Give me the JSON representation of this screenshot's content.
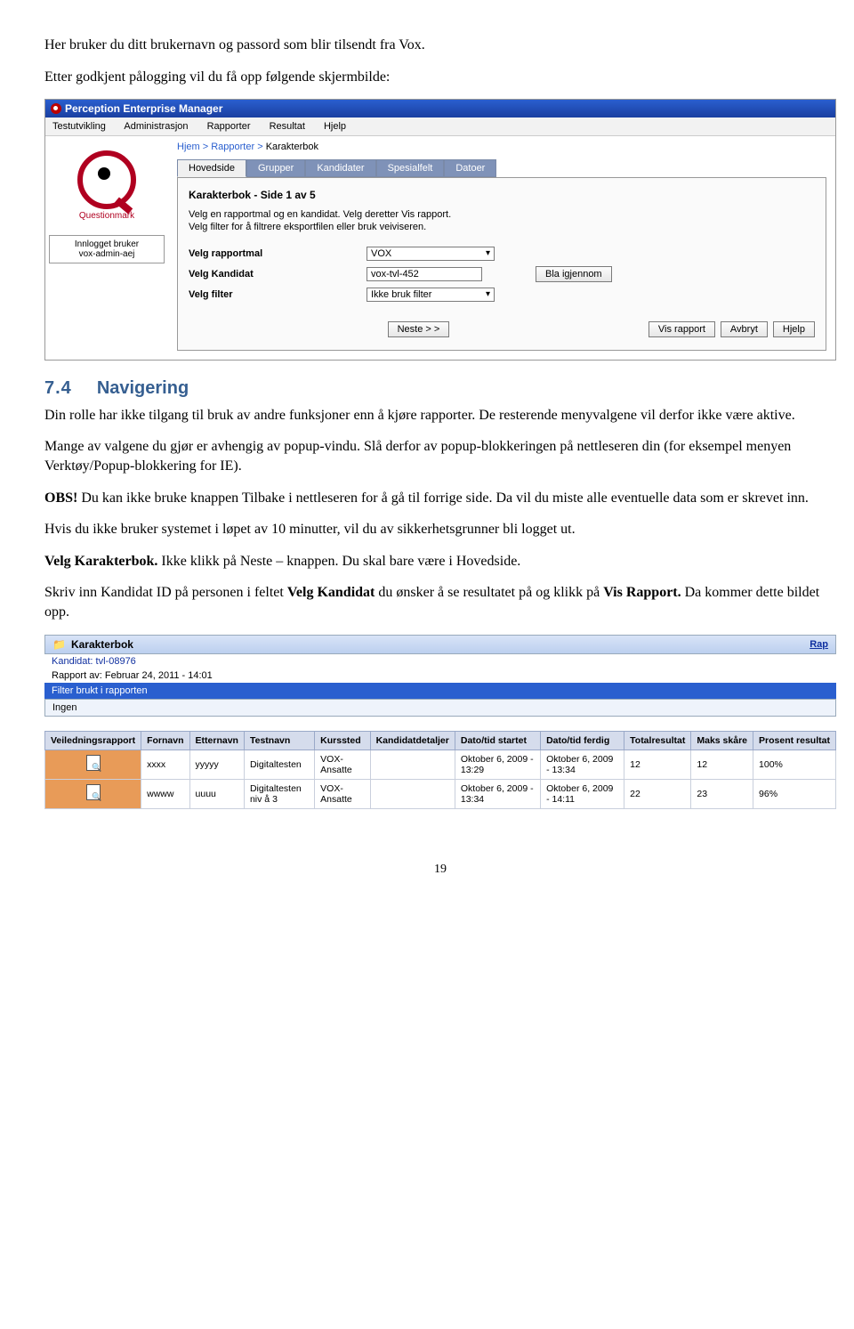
{
  "doc": {
    "p1": "Her bruker du ditt brukernavn og passord som blir tilsendt fra Vox.",
    "p2": "Etter godkjent pålogging vil du få opp følgende skjermbilde:",
    "section_num": "7.4",
    "section_title": "Navigering",
    "p3": "Din rolle har ikke tilgang til bruk av andre funksjoner enn å kjøre rapporter. De resterende menyvalgene vil derfor ikke være aktive.",
    "p4": "Mange av valgene du gjør er avhengig av popup-vindu. Slå derfor av popup-blokkeringen på nettleseren din (for eksempel menyen Verktøy/Popup-blokkering for IE).",
    "p5a": "OBS!",
    "p5b": " Du kan ikke bruke knappen Tilbake i nettleseren for å gå til forrige side. Da vil du miste alle eventuelle data som er skrevet inn.",
    "p6": "Hvis du ikke bruker systemet i løpet av 10 minutter, vil du av sikkerhetsgrunner bli logget ut.",
    "p7a": "Velg Karakterbok.",
    "p7b": " Ikke klikk på Neste – knappen. Du skal bare være i Hovedside.",
    "p8a": "Skriv inn Kandidat ID på personen i feltet ",
    "p8b": "Velg Kandidat",
    "p8c": " du ønsker å se resultatet på og klikk på ",
    "p8d": "Vis Rapport.",
    "p8e": " Da kommer dette bildet opp.",
    "page_number": "19"
  },
  "pem": {
    "window_title": "Perception Enterprise Manager",
    "menu": [
      "Testutvikling",
      "Administrasjon",
      "Rapporter",
      "Resultat",
      "Hjelp"
    ],
    "breadcrumb": {
      "a": "Hjem",
      "b": "Rapporter",
      "c": "Karakterbok"
    },
    "logo_text": "Questionmark",
    "user_label": "Innlogget bruker",
    "user_value": "vox-admin-aej",
    "tabs": [
      "Hovedside",
      "Grupper",
      "Kandidater",
      "Spesialfelt",
      "Datoer"
    ],
    "panel_title": "Karakterbok - Side 1 av 5",
    "panel_desc1": "Velg en rapportmal og en kandidat. Velg deretter Vis rapport.",
    "panel_desc2": "Velg filter for å filtrere eksportfilen eller bruk veiviseren.",
    "lbl_mal": "Velg rapportmal",
    "val_mal": "VOX",
    "lbl_kand": "Velg Kandidat",
    "val_kand": "vox-tvl-452",
    "btn_browse": "Bla igjennom",
    "lbl_filter": "Velg filter",
    "val_filter": "Ikke bruk filter",
    "btn_next": "Neste > >",
    "btn_show": "Vis rapport",
    "btn_cancel": "Avbryt",
    "btn_help": "Hjelp"
  },
  "kb": {
    "title": "Karakterbok",
    "rap_link": "Rap",
    "kandidat_lbl": "Kandidat:",
    "kandidat_val": "tvl-08976",
    "rapport_av": "Rapport av: Februar 24, 2011 - 14:01",
    "filter_title": "Filter brukt i rapporten",
    "filter_val": "Ingen",
    "headers": [
      "Veiledningsrapport",
      "Fornavn",
      "Etternavn",
      "Testnavn",
      "Kurssted",
      "Kandidatdetaljer",
      "Dato/tid startet",
      "Dato/tid ferdig",
      "Totalresultat",
      "Maks skåre",
      "Prosent resultat"
    ],
    "rows": [
      {
        "fornavn": "xxxx",
        "etternavn": "yyyyy",
        "test": "Digitaltesten",
        "kurs": "VOX-Ansatte",
        "det": "",
        "start": "Oktober 6, 2009 - 13:29",
        "slutt": "Oktober 6, 2009 - 13:34",
        "tot": "12",
        "maks": "12",
        "pros": "100%"
      },
      {
        "fornavn": "wwww",
        "etternavn": "uuuu",
        "test": "Digitaltesten niv å 3",
        "kurs": "VOX-Ansatte",
        "det": "",
        "start": "Oktober 6, 2009 - 13:34",
        "slutt": "Oktober 6, 2009 - 14:11",
        "tot": "22",
        "maks": "23",
        "pros": "96%"
      }
    ]
  }
}
